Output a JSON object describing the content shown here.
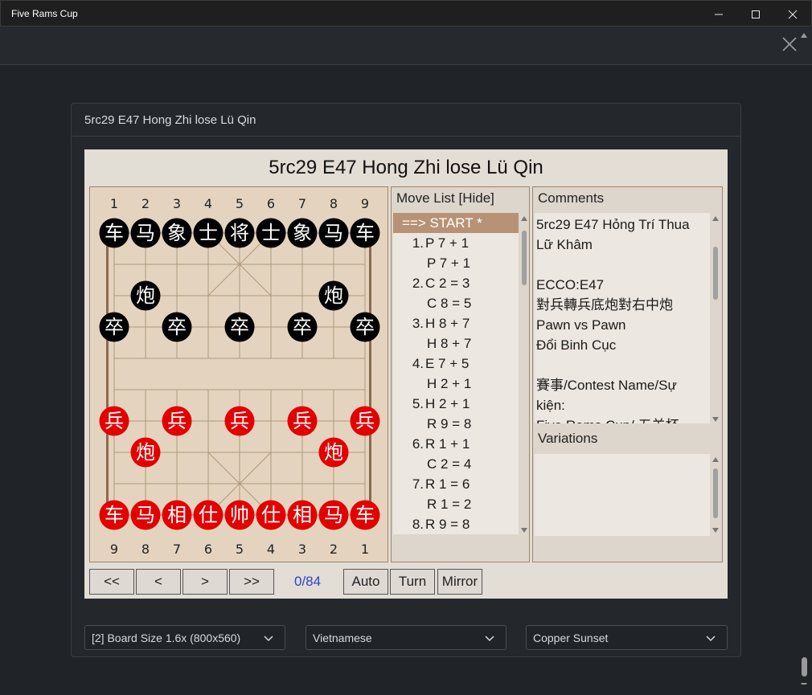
{
  "window": {
    "title": "Five Rams Cup"
  },
  "card": {
    "title": "5rc29 E47 Hong Zhi lose Lü Qin"
  },
  "game": {
    "title": "5rc29 E47 Hong Zhi lose Lü Qin",
    "top_files": [
      "1",
      "2",
      "3",
      "4",
      "5",
      "6",
      "7",
      "8",
      "9"
    ],
    "bottom_files": [
      "9",
      "8",
      "7",
      "6",
      "5",
      "4",
      "3",
      "2",
      "1"
    ],
    "pieces": [
      {
        "t": "车",
        "c": "black",
        "f": 0,
        "r": 0
      },
      {
        "t": "马",
        "c": "black",
        "f": 1,
        "r": 0
      },
      {
        "t": "象",
        "c": "black",
        "f": 2,
        "r": 0
      },
      {
        "t": "士",
        "c": "black",
        "f": 3,
        "r": 0
      },
      {
        "t": "将",
        "c": "black",
        "f": 4,
        "r": 0
      },
      {
        "t": "士",
        "c": "black",
        "f": 5,
        "r": 0
      },
      {
        "t": "象",
        "c": "black",
        "f": 6,
        "r": 0
      },
      {
        "t": "马",
        "c": "black",
        "f": 7,
        "r": 0
      },
      {
        "t": "车",
        "c": "black",
        "f": 8,
        "r": 0
      },
      {
        "t": "炮",
        "c": "black",
        "f": 1,
        "r": 2
      },
      {
        "t": "炮",
        "c": "black",
        "f": 7,
        "r": 2
      },
      {
        "t": "卒",
        "c": "black",
        "f": 0,
        "r": 3
      },
      {
        "t": "卒",
        "c": "black",
        "f": 2,
        "r": 3
      },
      {
        "t": "卒",
        "c": "black",
        "f": 4,
        "r": 3
      },
      {
        "t": "卒",
        "c": "black",
        "f": 6,
        "r": 3
      },
      {
        "t": "卒",
        "c": "black",
        "f": 8,
        "r": 3
      },
      {
        "t": "兵",
        "c": "red",
        "f": 0,
        "r": 6
      },
      {
        "t": "兵",
        "c": "red",
        "f": 2,
        "r": 6
      },
      {
        "t": "兵",
        "c": "red",
        "f": 4,
        "r": 6
      },
      {
        "t": "兵",
        "c": "red",
        "f": 6,
        "r": 6
      },
      {
        "t": "兵",
        "c": "red",
        "f": 8,
        "r": 6
      },
      {
        "t": "炮",
        "c": "red",
        "f": 1,
        "r": 7
      },
      {
        "t": "炮",
        "c": "red",
        "f": 7,
        "r": 7
      },
      {
        "t": "车",
        "c": "red",
        "f": 0,
        "r": 9
      },
      {
        "t": "马",
        "c": "red",
        "f": 1,
        "r": 9
      },
      {
        "t": "相",
        "c": "red",
        "f": 2,
        "r": 9
      },
      {
        "t": "仕",
        "c": "red",
        "f": 3,
        "r": 9
      },
      {
        "t": "帅",
        "c": "red",
        "f": 4,
        "r": 9
      },
      {
        "t": "仕",
        "c": "red",
        "f": 5,
        "r": 9
      },
      {
        "t": "相",
        "c": "red",
        "f": 6,
        "r": 9
      },
      {
        "t": "马",
        "c": "red",
        "f": 7,
        "r": 9
      },
      {
        "t": "车",
        "c": "red",
        "f": 8,
        "r": 9
      }
    ],
    "colors": {
      "black_piece": "#000000",
      "red_piece": "#e30000",
      "board": "#e4d4bf",
      "line": "#b0977c"
    }
  },
  "movelist": {
    "header": "Move List [Hide]",
    "start": "==> START *",
    "moves": [
      {
        "num": "1.",
        "red": "P 7 + 1",
        "black": "P 7 + 1"
      },
      {
        "num": "2.",
        "red": "C 2 = 3",
        "black": "C 8 = 5"
      },
      {
        "num": "3.",
        "red": "H 8 + 7",
        "black": "H 8 + 7"
      },
      {
        "num": "4.",
        "red": "E 7 + 5",
        "black": "H 2 + 1"
      },
      {
        "num": "5.",
        "red": "H 2 + 1",
        "black": "R 9 = 8"
      },
      {
        "num": "6.",
        "red": "R 1 + 1",
        "black": "C 2 = 4"
      },
      {
        "num": "7.",
        "red": "R 1 = 6",
        "black": "R 1 = 2"
      },
      {
        "num": "8.",
        "red": "R 9 = 8",
        "black": ""
      }
    ]
  },
  "comments": {
    "header": "Comments",
    "lines": [
      "5rc29 E47 Hỏng Trí Thua",
      "Lữ Khâm",
      "",
      "ECCO:E47",
      "對兵轉兵底炮對右中炮",
      "Pawn vs Pawn",
      "Đổi Binh Cục",
      "",
      "賽事/Contest Name/Sự",
      "kiện:",
      "Five Rams Cup/ 五羊杯"
    ],
    "variations_header": "Variations"
  },
  "controls": {
    "first": "<<",
    "prev": "<",
    "next": ">",
    "last": ">>",
    "counter": "0/84",
    "auto": "Auto",
    "turn": "Turn",
    "mirror": "Mirror"
  },
  "selects": {
    "board_size": "[2] Board Size 1.6x (800x560)",
    "language": "Vietnamese",
    "theme": "Copper Sunset"
  }
}
